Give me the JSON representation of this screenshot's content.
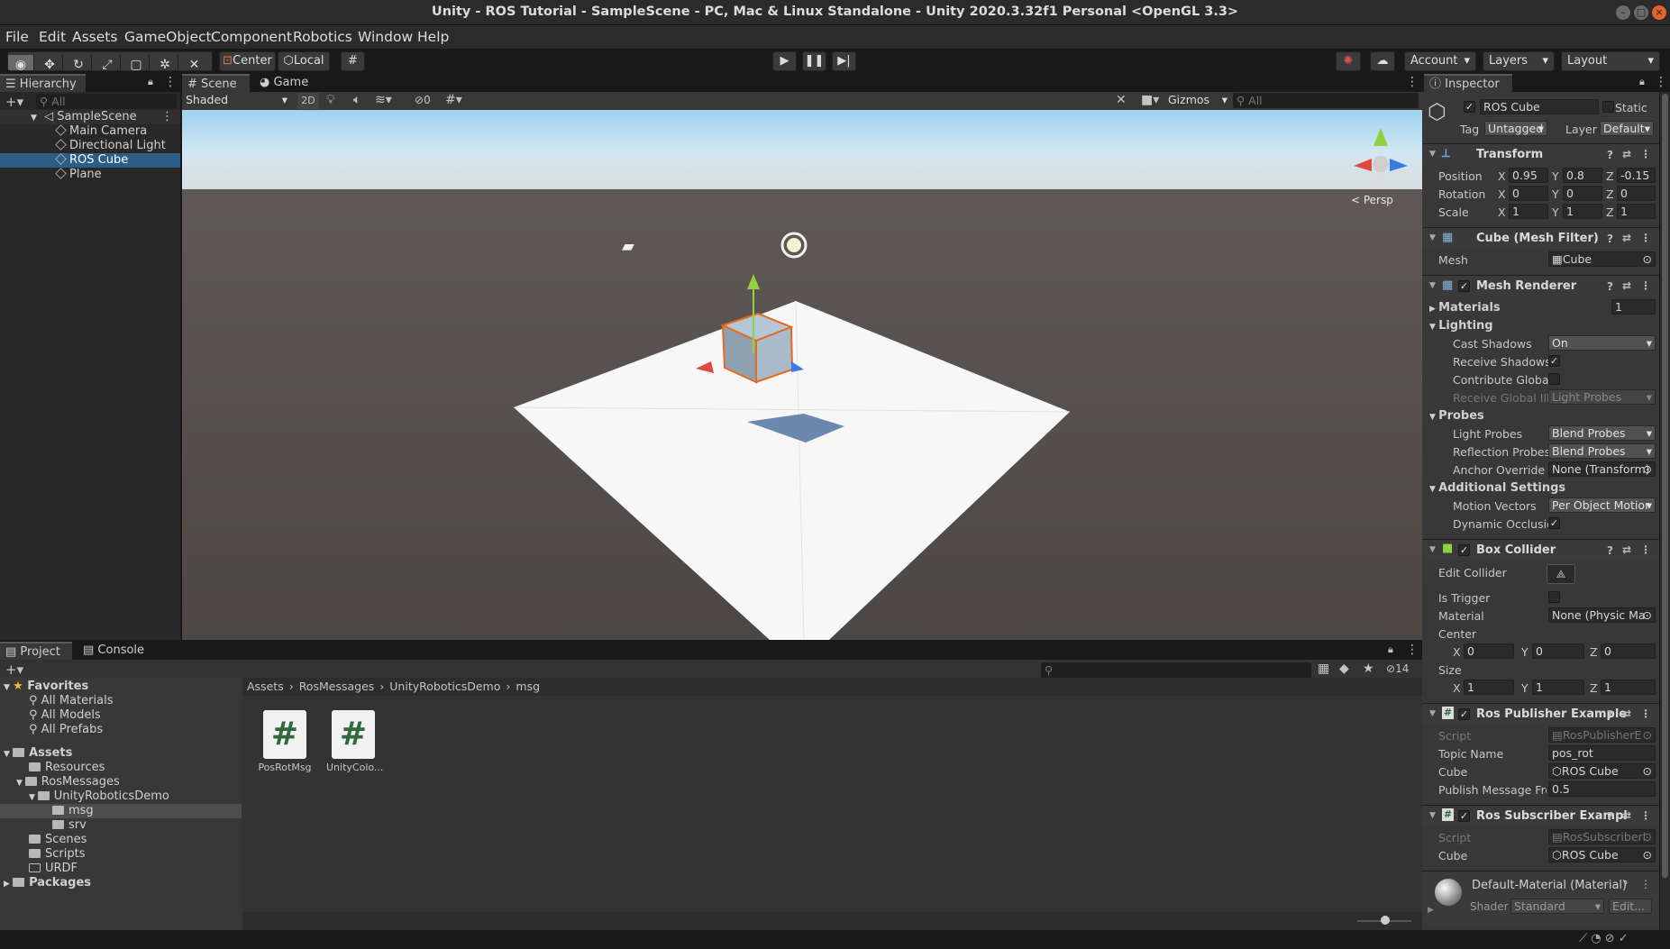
{
  "window": {
    "title": "Unity - ROS Tutorial - SampleScene - PC, Mac & Linux Standalone - Unity 2020.3.32f1 Personal <OpenGL 3.3>"
  },
  "menu": [
    "File",
    "Edit",
    "Assets",
    "GameObject",
    "Component",
    "Robotics",
    "Window",
    "Help"
  ],
  "toolbar": {
    "pivot": "Center",
    "space": "Local",
    "account": "Account",
    "layers": "Layers",
    "layout": "Layout"
  },
  "hierarchy": {
    "tab": "Hierarchy",
    "search_placeholder": "All",
    "scene": "SampleScene",
    "items": [
      "Main Camera",
      "Directional Light",
      "ROS Cube",
      "Plane"
    ],
    "selected": "ROS Cube"
  },
  "scene_view": {
    "tabs": [
      "Scene",
      "Game"
    ],
    "shading": "Shaded",
    "mode_2d": "2D",
    "hidden_count": "0",
    "gizmos": "Gizmos",
    "search_placeholder": "All",
    "persp": "< Persp"
  },
  "project": {
    "tabs": [
      "Project",
      "Console"
    ],
    "favorites_label": "Favorites",
    "favorites": [
      "All Materials",
      "All Models",
      "All Prefabs"
    ],
    "assets_label": "Assets",
    "tree": [
      "Resources",
      "RosMessages",
      "UnityRoboticsDemo",
      "msg",
      "srv",
      "Scenes",
      "Scripts",
      "URDF"
    ],
    "packages_label": "Packages",
    "breadcrumb": [
      "Assets",
      "RosMessages",
      "UnityRoboticsDemo",
      "msg"
    ],
    "files": [
      "PosRotMsg",
      "UnityColo..."
    ],
    "hidden_count": "14"
  },
  "inspector": {
    "tab": "Inspector",
    "object_name": "ROS Cube",
    "static_label": "Static",
    "tag_label": "Tag",
    "tag": "Untagged",
    "layer_label": "Layer",
    "layer": "Default",
    "transform": {
      "title": "Transform",
      "position_label": "Position",
      "position": [
        "0.95",
        "0.8",
        "-0.15"
      ],
      "rotation_label": "Rotation",
      "rotation": [
        "0",
        "0",
        "0"
      ],
      "scale_label": "Scale",
      "scale": [
        "1",
        "1",
        "1"
      ]
    },
    "mesh_filter": {
      "title": "Cube (Mesh Filter)",
      "mesh_label": "Mesh",
      "mesh": "Cube"
    },
    "mesh_renderer": {
      "title": "Mesh Renderer",
      "materials_label": "Materials",
      "materials_count": "1",
      "lighting_label": "Lighting",
      "cast_shadows_label": "Cast Shadows",
      "cast_shadows": "On",
      "receive_shadows_label": "Receive Shadows",
      "contribute_gi_label": "Contribute Global I",
      "receive_gi_label": "Receive Global Illu",
      "receive_gi": "Light Probes",
      "probes_label": "Probes",
      "light_probes_label": "Light Probes",
      "light_probes": "Blend Probes",
      "reflection_probes_label": "Reflection Probes",
      "reflection_probes": "Blend Probes",
      "anchor_override_label": "Anchor Override",
      "anchor_override": "None (Transform)",
      "additional_label": "Additional Settings",
      "motion_vectors_label": "Motion Vectors",
      "motion_vectors": "Per Object Motior",
      "dynamic_occlusion_label": "Dynamic Occlusio"
    },
    "box_collider": {
      "title": "Box Collider",
      "edit_collider_label": "Edit Collider",
      "is_trigger_label": "Is Trigger",
      "material_label": "Material",
      "material": "None (Physic Ma",
      "center_label": "Center",
      "center": [
        "0",
        "0",
        "0"
      ],
      "size_label": "Size",
      "size": [
        "1",
        "1",
        "1"
      ]
    },
    "ros_publisher": {
      "title": "Ros Publisher Example",
      "script_label": "Script",
      "script": "RosPublisherE",
      "topic_label": "Topic Name",
      "topic": "pos_rot",
      "cube_label": "Cube",
      "cube": "ROS Cube",
      "freq_label": "Publish Message Frec",
      "freq": "0.5"
    },
    "ros_subscriber": {
      "title": "Ros Subscriber Exampl",
      "script_label": "Script",
      "script": "RosSubscriberl",
      "cube_label": "Cube",
      "cube": "ROS Cube"
    },
    "material": {
      "title": "Default-Material (Material)",
      "shader_label": "Shader",
      "shader": "Standard",
      "edit": "Edit..."
    }
  }
}
